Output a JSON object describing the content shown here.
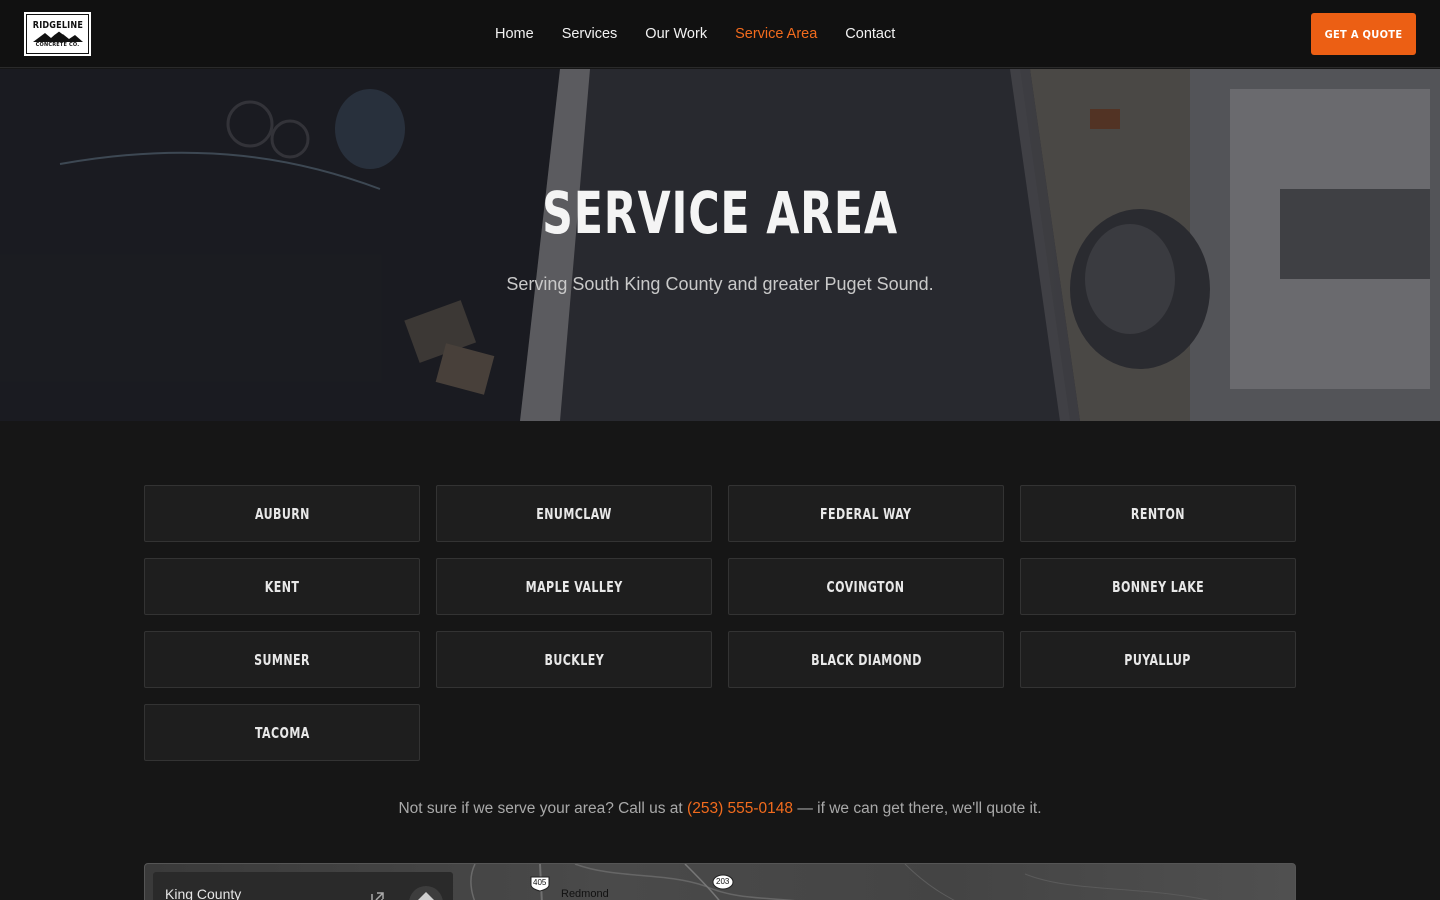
{
  "header": {
    "logo": {
      "line1": "RIDGELINE",
      "line2": "CONCRETE CO."
    },
    "nav": [
      {
        "label": "Home",
        "active": false
      },
      {
        "label": "Services",
        "active": false
      },
      {
        "label": "Our Work",
        "active": false
      },
      {
        "label": "Service Area",
        "active": true
      },
      {
        "label": "Contact",
        "active": false
      }
    ],
    "cta_label": "GET A QUOTE"
  },
  "hero": {
    "title": "SERVICE AREA",
    "subtitle": "Serving South King County and greater Puget Sound."
  },
  "areas": [
    "AUBURN",
    "ENUMCLAW",
    "FEDERAL WAY",
    "RENTON",
    "KENT",
    "MAPLE VALLEY",
    "COVINGTON",
    "BONNEY LAKE",
    "SUMNER",
    "BUCKLEY",
    "BLACK DIAMOND",
    "PUYALLUP",
    "TACOMA"
  ],
  "note": {
    "before": "Not sure if we serve your area? Call us at ",
    "phone": "(253) 555-0148",
    "after": " — if we can get there, we'll quote it."
  },
  "map": {
    "card_title": "King County",
    "place_label": "Redmond",
    "shields": [
      "405",
      "203"
    ]
  },
  "colors": {
    "accent": "#f26b1d",
    "cta_bg": "#ec5f14",
    "page_bg": "#161616",
    "header_bg": "#111111"
  },
  "icons": [
    "external-link-icon",
    "directions-icon"
  ]
}
